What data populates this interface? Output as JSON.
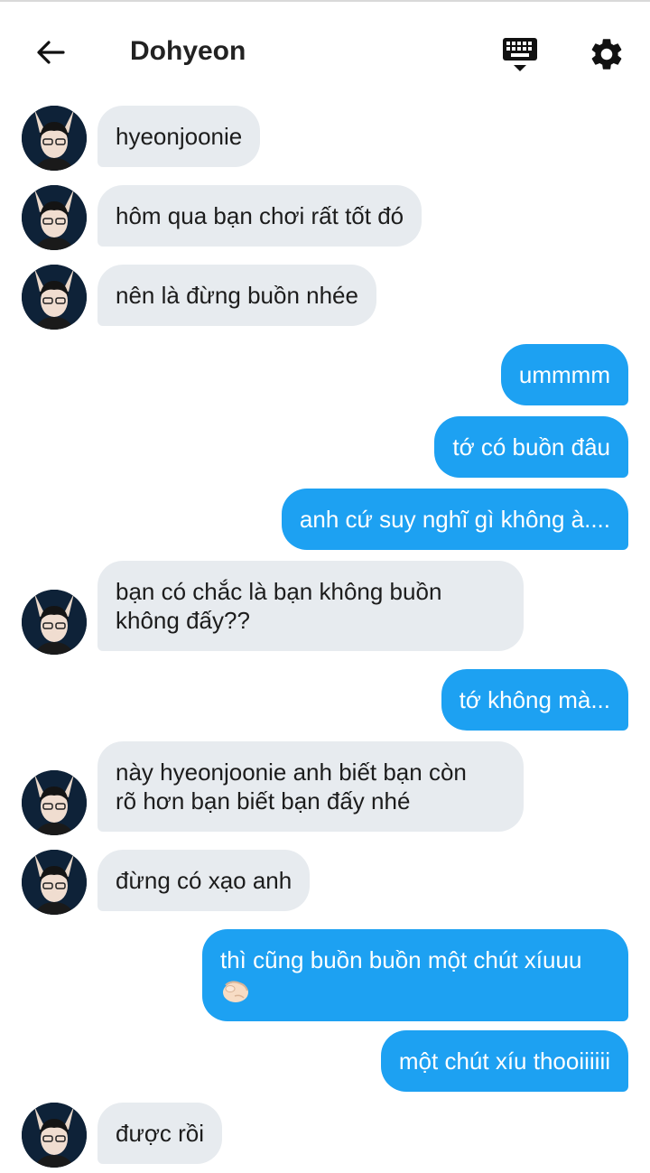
{
  "header": {
    "back_icon": "arrow-left-icon",
    "title": "Dohyeon",
    "keyboard_icon": "keyboard-icon",
    "settings_icon": "gear-icon"
  },
  "colors": {
    "outgoing_bubble": "#1da1f2",
    "incoming_bubble": "#e7ebef"
  },
  "messages": [
    {
      "from": "them",
      "lines": [
        "hyeonjoonie"
      ]
    },
    {
      "from": "them",
      "lines": [
        "hôm qua bạn chơi rất tốt đó"
      ]
    },
    {
      "from": "them",
      "lines": [
        "nên là đừng buồn nhée"
      ]
    },
    {
      "from": "me",
      "lines": [
        "ummmm"
      ]
    },
    {
      "from": "me",
      "lines": [
        "tớ có buồn đâu"
      ]
    },
    {
      "from": "me",
      "lines": [
        "anh cứ suy nghĩ gì không à...."
      ]
    },
    {
      "from": "them",
      "lines": [
        "bạn có chắc là bạn không buồn",
        "không đấy??"
      ]
    },
    {
      "from": "me",
      "lines": [
        "tớ không mà..."
      ]
    },
    {
      "from": "them",
      "lines": [
        "này hyeonjoonie anh biết bạn còn",
        "rõ hơn bạn biết bạn đấy nhé"
      ]
    },
    {
      "from": "them",
      "lines": [
        "đừng có xạo anh"
      ]
    },
    {
      "from": "me",
      "lines": [
        "thì cũng buồn buồn một chút xíuuu"
      ],
      "emoji": "pinching-hand-icon"
    },
    {
      "from": "me",
      "lines": [
        "một chút xíu thooiiiiii"
      ]
    },
    {
      "from": "them",
      "lines": [
        "được rồi"
      ]
    }
  ]
}
